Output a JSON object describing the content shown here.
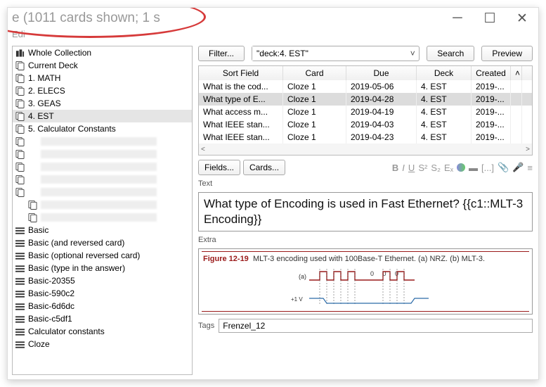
{
  "title_fragment": "e (1011 cards shown; 1 s",
  "menubar_fragment": "Edi",
  "sidebar": {
    "items": [
      {
        "label": "Whole Collection",
        "icon": "collection",
        "sub": false
      },
      {
        "label": "Current Deck",
        "icon": "deck",
        "sub": false
      },
      {
        "label": "1. MATH",
        "icon": "deck",
        "sub": false
      },
      {
        "label": "2. ELECS",
        "icon": "deck",
        "sub": false
      },
      {
        "label": "3. GEAS",
        "icon": "deck",
        "sub": false
      },
      {
        "label": "4. EST",
        "icon": "deck",
        "sub": false,
        "selected": true
      },
      {
        "label": "5. Calculator Constants",
        "icon": "deck",
        "sub": false
      },
      {
        "label": "",
        "icon": "deck",
        "sub": false,
        "placeholder": true
      },
      {
        "label": "",
        "icon": "deck",
        "sub": false,
        "placeholder": true
      },
      {
        "label": "",
        "icon": "deck",
        "sub": false,
        "placeholder": true
      },
      {
        "label": "",
        "icon": "deck",
        "sub": false,
        "placeholder": true
      },
      {
        "label": "",
        "icon": "deck",
        "sub": false,
        "placeholder": true
      },
      {
        "label": "",
        "icon": "deck",
        "sub": true,
        "placeholder": true
      },
      {
        "label": "",
        "icon": "deck",
        "sub": true,
        "placeholder": true
      },
      {
        "label": "Basic",
        "icon": "notetype",
        "sub": false
      },
      {
        "label": "Basic (and reversed card)",
        "icon": "notetype",
        "sub": false
      },
      {
        "label": "Basic (optional reversed card)",
        "icon": "notetype",
        "sub": false
      },
      {
        "label": "Basic (type in the answer)",
        "icon": "notetype",
        "sub": false
      },
      {
        "label": "Basic-20355",
        "icon": "notetype",
        "sub": false
      },
      {
        "label": "Basic-590c2",
        "icon": "notetype",
        "sub": false
      },
      {
        "label": "Basic-6d6dc",
        "icon": "notetype",
        "sub": false
      },
      {
        "label": "Basic-c5df1",
        "icon": "notetype",
        "sub": false
      },
      {
        "label": "Calculator constants",
        "icon": "notetype",
        "sub": false
      },
      {
        "label": "Cloze",
        "icon": "notetype",
        "sub": false
      }
    ]
  },
  "toolbar": {
    "filter": "Filter...",
    "search_value": "\"deck:4. EST\"",
    "search": "Search",
    "preview": "Preview"
  },
  "table": {
    "columns": [
      "Sort Field",
      "Card",
      "Due",
      "Deck",
      "Created"
    ],
    "rows": [
      {
        "sort": "What is the cod...",
        "card": "Cloze 1",
        "due": "2019-05-06",
        "deck": "4. EST",
        "created": "2019-..."
      },
      {
        "sort": "What type of E...",
        "card": "Cloze 1",
        "due": "2019-04-28",
        "deck": "4. EST",
        "created": "2019-...",
        "selected": true
      },
      {
        "sort": "What access m...",
        "card": "Cloze 1",
        "due": "2019-04-19",
        "deck": "4. EST",
        "created": "2019-..."
      },
      {
        "sort": "What IEEE stan...",
        "card": "Cloze 1",
        "due": "2019-04-03",
        "deck": "4. EST",
        "created": "2019-..."
      },
      {
        "sort": "What IEEE stan...",
        "card": "Cloze 1",
        "due": "2019-04-23",
        "deck": "4. EST",
        "created": "2019-..."
      }
    ]
  },
  "editbar": {
    "fields": "Fields...",
    "cards": "Cards..."
  },
  "editor": {
    "text_label": "Text",
    "text_value": "What type of Encoding is used in Fast Ethernet? {{c1::MLT-3 Encoding}}",
    "extra_label": "Extra",
    "figure_num": "Figure 12-19",
    "figure_caption": "MLT-3 encoding used with 100Base-T Ethernet. (a) NRZ. (b) MLT-3.",
    "wave_a": "(a)",
    "wave_seq": "0  0  0",
    "wave_v": "+1 V",
    "tags_label": "Tags",
    "tags_value": "Frenzel_12"
  }
}
